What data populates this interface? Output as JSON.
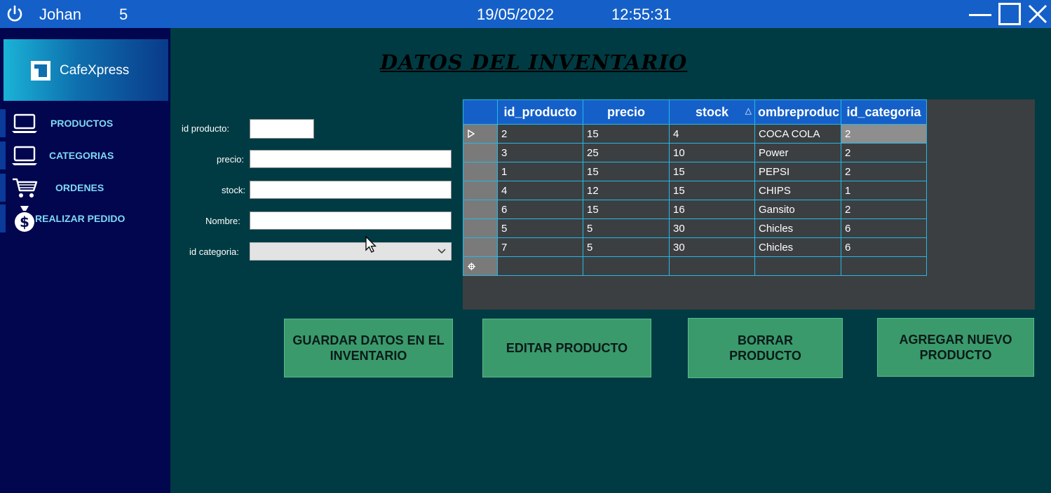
{
  "titlebar": {
    "user": "Johan",
    "user_id": "5",
    "date": "19/05/2022",
    "time": "12:55:31",
    "icons": [
      "power-icon",
      "minimize-icon",
      "maximize-icon",
      "close-icon"
    ]
  },
  "sidebar": {
    "logo_text": "CafeXpress",
    "items": [
      {
        "label": "PRODUCTOS",
        "icon": "laptop-icon"
      },
      {
        "label": "CATEGORIAS",
        "icon": "laptop-icon"
      },
      {
        "label": "ORDENES",
        "icon": "cart-icon"
      },
      {
        "label": "REALIZAR PEDIDO",
        "icon": "money-bag-icon"
      }
    ]
  },
  "heading": "DATOS DEL INVENTARIO",
  "form": {
    "id_producto_label": "id producto:",
    "precio_label": "precio:",
    "stock_label": "stock:",
    "nombre_label": "Nombre:",
    "id_categoria_label": "id categoria:"
  },
  "grid": {
    "columns": [
      "id_producto",
      "precio",
      "stock",
      "ombreproduc",
      "id_categoria"
    ],
    "sort_indicator": "△",
    "rows": [
      [
        "2",
        "15",
        "4",
        "COCA COLA",
        "2"
      ],
      [
        "3",
        "25",
        "10",
        "Power",
        "2"
      ],
      [
        "1",
        "15",
        "15",
        "PEPSI",
        "2"
      ],
      [
        "4",
        "12",
        "15",
        "CHIPS",
        "1"
      ],
      [
        "6",
        "15",
        "16",
        "Gansito",
        "2"
      ],
      [
        "5",
        "5",
        "30",
        "Chicles",
        "6"
      ],
      [
        "7",
        "5",
        "30",
        "Chicles",
        "6"
      ]
    ]
  },
  "buttons": {
    "guardar": "GUARDAR DATOS EN EL INVENTARIO",
    "editar": "EDITAR PRODUCTO",
    "borrar": "BORRAR PRODUCTO",
    "agregar": "AGREGAR NUEVO PRODUCTO"
  },
  "colors": {
    "titlebar": "#1560c8",
    "sidebar": "#02064e",
    "background": "#003b43",
    "button": "#3a9a6c",
    "grid_border": "#25b8e6"
  }
}
